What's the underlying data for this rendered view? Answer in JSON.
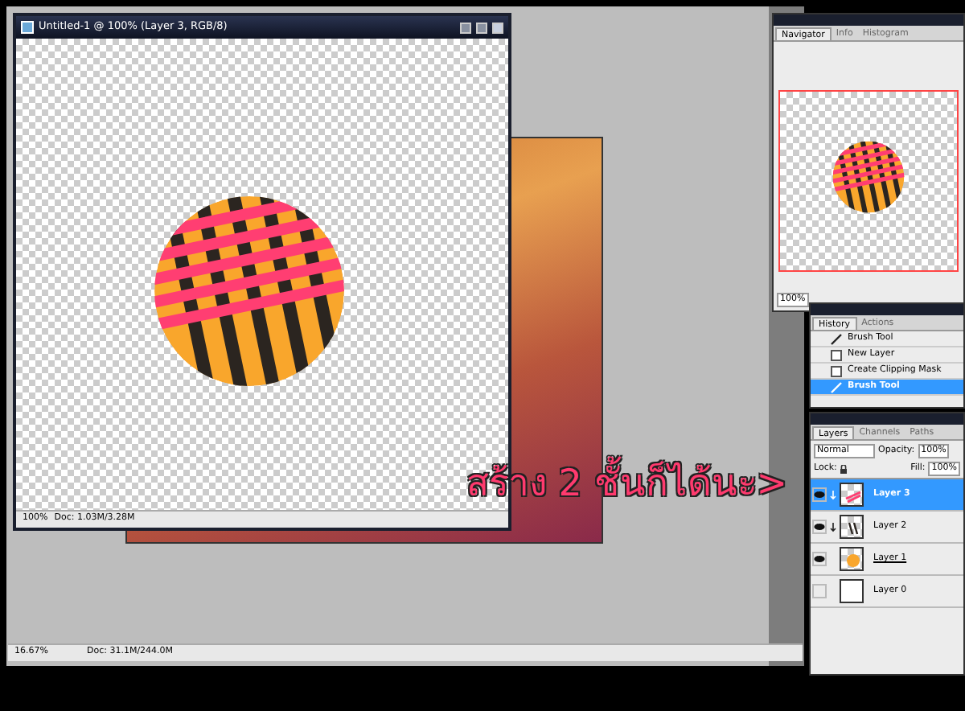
{
  "document_window": {
    "title": "Untitled-1 @ 100% (Layer 3, RGB/8)",
    "zoom": "100%",
    "doc_size": "Doc: 1.03M/3.28M"
  },
  "background_document": {
    "zoom": "16.67%",
    "doc_size": "Doc: 31.1M/244.0M"
  },
  "navigator": {
    "tabs": [
      {
        "label": "Navigator",
        "selected": true
      },
      {
        "label": "Info",
        "selected": false
      },
      {
        "label": "Histogram",
        "selected": false
      }
    ],
    "zoom": "100%"
  },
  "history": {
    "tabs": [
      {
        "label": "History",
        "selected": true
      },
      {
        "label": "Actions",
        "selected": false
      }
    ],
    "items": [
      {
        "label": "Brush Tool",
        "kind": "brush",
        "selected": false
      },
      {
        "label": "New Layer",
        "kind": "layer",
        "selected": false
      },
      {
        "label": "Create Clipping Mask",
        "kind": "layer",
        "selected": false
      },
      {
        "label": "Brush Tool",
        "kind": "brush",
        "selected": true
      }
    ]
  },
  "layers": {
    "tabs": [
      {
        "label": "Layers",
        "selected": true
      },
      {
        "label": "Channels",
        "selected": false
      },
      {
        "label": "Paths",
        "selected": false
      }
    ],
    "blend_mode": "Normal",
    "opacity_label": "Opacity:",
    "opacity": "100%",
    "lock_label": "Lock:",
    "fill_label": "Fill:",
    "fill": "100%",
    "items": [
      {
        "name": "Layer 3",
        "kind": "pink-stripes",
        "visible": true,
        "clipped": true,
        "underlined": false,
        "selected": true
      },
      {
        "name": "Layer 2",
        "kind": "dark-stripes",
        "visible": true,
        "clipped": true,
        "underlined": false,
        "selected": false
      },
      {
        "name": "Layer 1",
        "kind": "circle",
        "visible": true,
        "clipped": false,
        "underlined": true,
        "selected": false
      },
      {
        "name": "Layer 0",
        "kind": "blank",
        "visible": false,
        "clipped": false,
        "underlined": false,
        "selected": false
      }
    ]
  },
  "caption": "สร้าง 2 ชั้นก็ได้นะ>"
}
